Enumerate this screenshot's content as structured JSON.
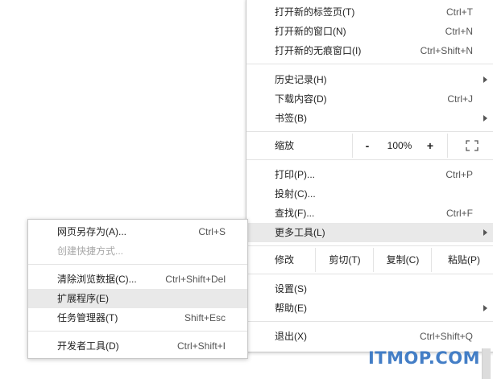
{
  "main_menu": {
    "new_tab": {
      "label": "打开新的标签页(T)",
      "shortcut": "Ctrl+T"
    },
    "new_window": {
      "label": "打开新的窗口(N)",
      "shortcut": "Ctrl+N"
    },
    "new_incognito": {
      "label": "打开新的无痕窗口(I)",
      "shortcut": "Ctrl+Shift+N"
    },
    "history": {
      "label": "历史记录(H)"
    },
    "downloads": {
      "label": "下载内容(D)",
      "shortcut": "Ctrl+J"
    },
    "bookmarks": {
      "label": "书签(B)"
    },
    "zoom": {
      "label": "缩放",
      "minus": "-",
      "value": "100%",
      "plus": "+"
    },
    "print": {
      "label": "打印(P)...",
      "shortcut": "Ctrl+P"
    },
    "cast": {
      "label": "投射(C)..."
    },
    "find": {
      "label": "查找(F)...",
      "shortcut": "Ctrl+F"
    },
    "more_tools": {
      "label": "更多工具(L)"
    },
    "edit": {
      "label": "修改",
      "cut": "剪切(T)",
      "copy": "复制(C)",
      "paste": "粘贴(P)"
    },
    "settings": {
      "label": "设置(S)"
    },
    "help": {
      "label": "帮助(E)"
    },
    "exit": {
      "label": "退出(X)",
      "shortcut": "Ctrl+Shift+Q"
    }
  },
  "sub_menu": {
    "save_page": {
      "label": "网页另存为(A)...",
      "shortcut": "Ctrl+S"
    },
    "create_shortcut": {
      "label": "创建快捷方式..."
    },
    "clear_data": {
      "label": "清除浏览数据(C)...",
      "shortcut": "Ctrl+Shift+Del"
    },
    "extensions": {
      "label": "扩展程序(E)"
    },
    "task_manager": {
      "label": "任务管理器(T)",
      "shortcut": "Shift+Esc"
    },
    "dev_tools": {
      "label": "开发者工具(D)",
      "shortcut": "Ctrl+Shift+I"
    }
  },
  "watermark": "ITMOP.COM",
  "colors": {
    "highlight": "#e9e9e9",
    "watermark": "#3a78c4",
    "disabled_text": "#a8a8a8"
  }
}
